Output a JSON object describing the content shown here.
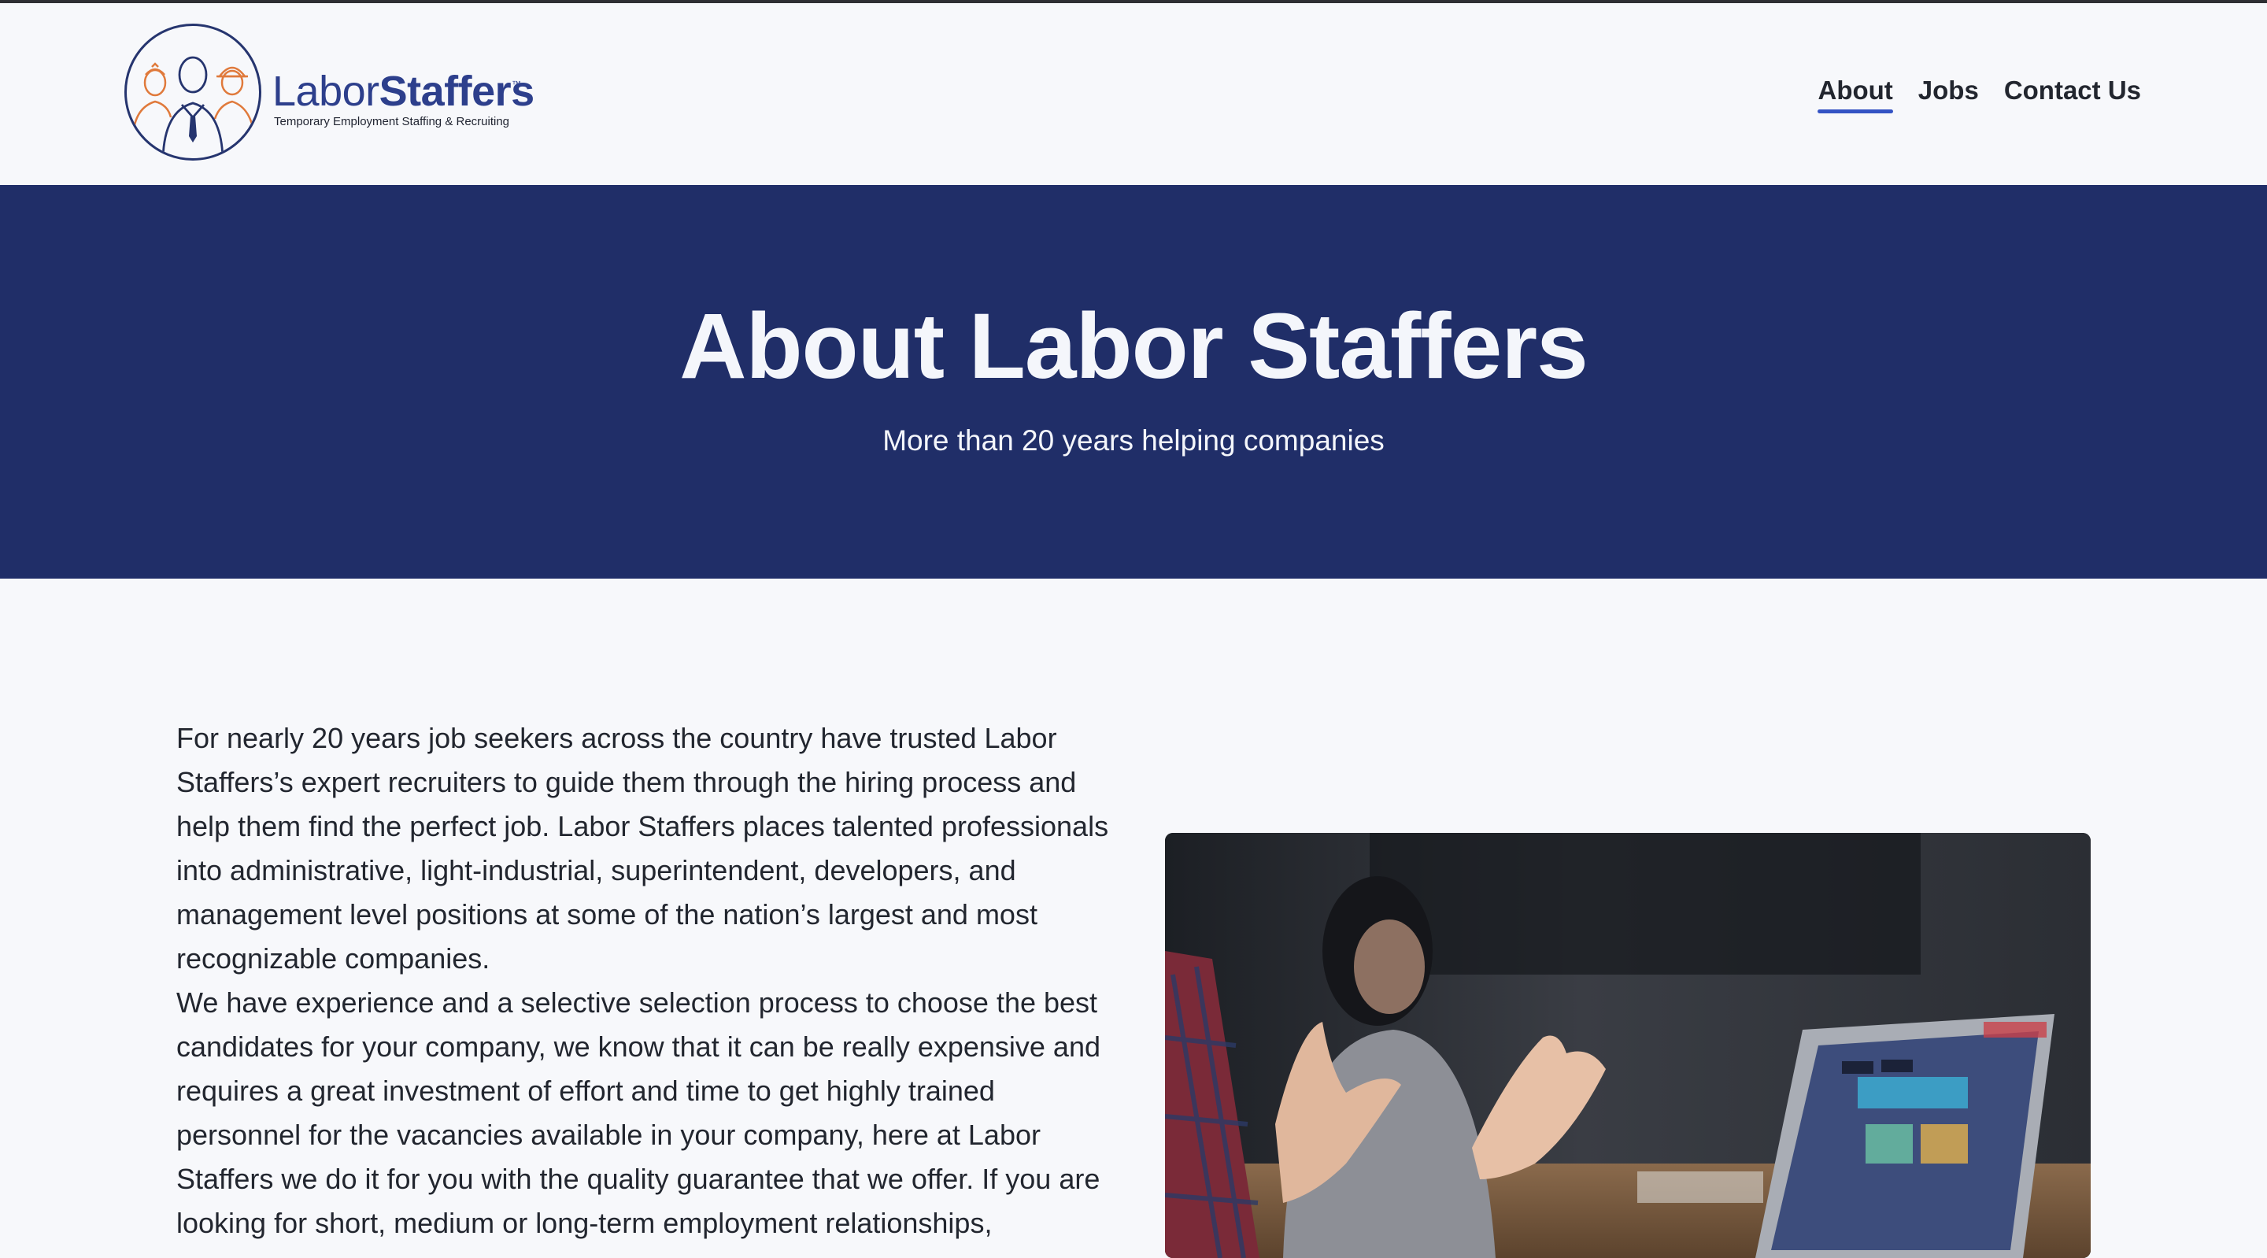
{
  "logo": {
    "word_light": "Labor",
    "word_bold": "Staffers",
    "trademark": "™",
    "tagline": "Temporary Employment Staffing & Recruiting"
  },
  "nav": {
    "items": [
      {
        "label": "About",
        "active": true
      },
      {
        "label": "Jobs",
        "active": false
      },
      {
        "label": "Contact Us",
        "active": false
      }
    ]
  },
  "hero": {
    "title": "About Labor Staffers",
    "subtitle": "More than 20 years helping companies"
  },
  "content": {
    "paragraph_1": "For nearly 20 years job seekers across the country have trusted Labor Staffers’s expert recruiters to guide them through the hiring process and help them find the perfect job. Labor Staffers places talented professionals into administrative, light-industrial, superintendent, developers, and management level positions at some of the nation’s largest and most recognizable companies.",
    "paragraph_2": "We have experience and a selective selection process to choose the best candidates for your company, we know that it can be really expensive and requires a great investment of effort and time to get highly trained personnel for the vacancies available in your company, here at Labor Staffers we do it for you with the quality guarantee that we offer. If you are looking for short, medium or long-term employment relationships,"
  },
  "colors": {
    "brand_navy": "#202e68",
    "logo_blue": "#2d3f8c",
    "logo_orange": "#e07a3c",
    "nav_underline": "#3453c4"
  }
}
